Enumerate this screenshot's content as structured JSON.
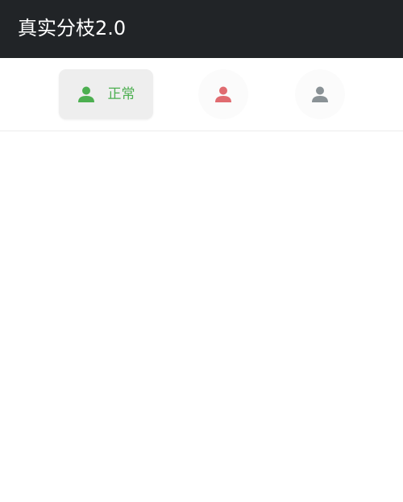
{
  "header": {
    "title": "真实分枝2.0",
    "background_color": "#212427"
  },
  "tabs": [
    {
      "label": "正常",
      "icon": "person-icon",
      "color": "#4caf50",
      "active": true
    },
    {
      "label": "",
      "icon": "person-icon",
      "color": "#e06b70",
      "active": false
    },
    {
      "label": "",
      "icon": "person-icon",
      "color": "#8a9296",
      "active": false
    }
  ]
}
